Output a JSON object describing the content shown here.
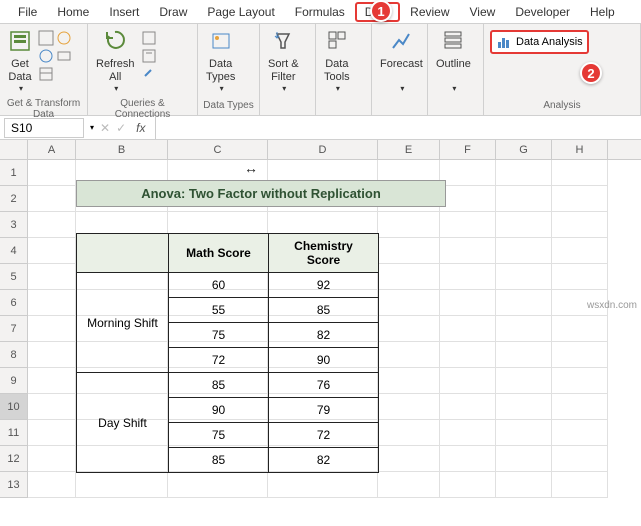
{
  "menu": {
    "items": [
      "File",
      "Home",
      "Insert",
      "Draw",
      "Page Layout",
      "Formulas",
      "Data",
      "Review",
      "View",
      "Developer",
      "Help"
    ],
    "active": "Data"
  },
  "badges": {
    "one": "1",
    "two": "2"
  },
  "ribbon": {
    "groups": [
      {
        "label": "Get & Transform Data",
        "buttons": [
          {
            "label": "Get\nData"
          }
        ]
      },
      {
        "label": "Queries & Connections",
        "buttons": [
          {
            "label": "Refresh\nAll"
          }
        ]
      },
      {
        "label": "Data Types",
        "buttons": [
          {
            "label": "Data\nTypes"
          }
        ]
      },
      {
        "label": "",
        "buttons": [
          {
            "label": "Sort &\nFilter"
          }
        ]
      },
      {
        "label": "",
        "buttons": [
          {
            "label": "Data\nTools"
          }
        ]
      },
      {
        "label": "",
        "buttons": [
          {
            "label": "Forecast"
          }
        ]
      },
      {
        "label": "",
        "buttons": [
          {
            "label": "Outline"
          }
        ]
      },
      {
        "label": "Analysis",
        "data_analysis": "Data Analysis"
      }
    ]
  },
  "namebox": "S10",
  "fx": "fx",
  "columns": [
    "A",
    "B",
    "C",
    "D",
    "E",
    "F",
    "G",
    "H"
  ],
  "rows": [
    "1",
    "2",
    "3",
    "4",
    "5",
    "6",
    "7",
    "8",
    "9",
    "10",
    "11",
    "12",
    "13"
  ],
  "selected_row": "10",
  "title": "Anova: Two Factor without Replication",
  "table": {
    "headers": [
      "",
      "Math Score",
      "Chemistry Score"
    ],
    "shifts": [
      "Morning Shift",
      "Day Shift"
    ],
    "data": {
      "morning": [
        {
          "math": "60",
          "chem": "92"
        },
        {
          "math": "55",
          "chem": "85"
        },
        {
          "math": "75",
          "chem": "82"
        },
        {
          "math": "72",
          "chem": "90"
        }
      ],
      "day": [
        {
          "math": "85",
          "chem": "76"
        },
        {
          "math": "90",
          "chem": "79"
        },
        {
          "math": "75",
          "chem": "72"
        },
        {
          "math": "85",
          "chem": "82"
        }
      ]
    }
  },
  "watermark": "wsxdn.com"
}
